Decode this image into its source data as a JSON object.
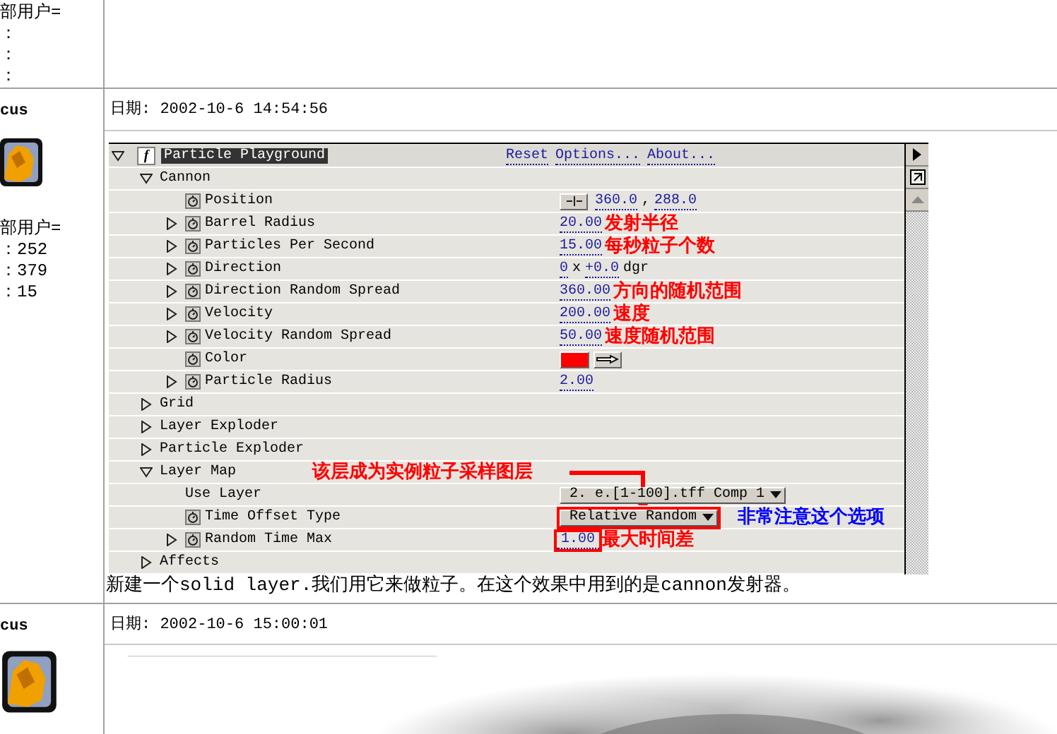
{
  "top_user": {
    "group": "部用户=",
    "stats": [
      "：",
      "：",
      "："
    ]
  },
  "posts": [
    {
      "user": {
        "name": "cus",
        "group": "部用户=",
        "stats": [
          "：252",
          "：379",
          "：15"
        ]
      },
      "date": "日期: 2002-10-6 14:54:56",
      "effect": {
        "title": "Particle Playground",
        "expanded": true,
        "switch": {
          "glyph": "f",
          "on": true
        },
        "links": [
          "Reset",
          "Options...",
          "About..."
        ],
        "properties": [
          {
            "label": "Cannon",
            "expanded": true,
            "stopwatch": false,
            "children": [
              {
                "label": "Position",
                "stopwatch": true,
                "kind": "point",
                "values": [
                  "360.0",
                  "288.0"
                ],
                "separator": ","
              },
              {
                "label": "Barrel Radius",
                "expanded": false,
                "stopwatch": true,
                "kind": "number",
                "value": "20.00",
                "note": {
                  "text": "发射半径",
                  "color": "#ff0000"
                }
              },
              {
                "label": "Particles Per Second",
                "expanded": false,
                "stopwatch": true,
                "kind": "number",
                "value": "15.00",
                "note": {
                  "text": "每秒粒子个数",
                  "color": "#ff0000"
                }
              },
              {
                "label": "Direction",
                "expanded": false,
                "stopwatch": true,
                "kind": "angle",
                "values": [
                  "0",
                  "+0.0"
                ],
                "separator": "x",
                "unit": "dgr"
              },
              {
                "label": "Direction Random Spread",
                "expanded": false,
                "stopwatch": true,
                "kind": "number",
                "value": "360.00",
                "note": {
                  "text": "方向的随机范围",
                  "color": "#ff0000"
                }
              },
              {
                "label": "Velocity",
                "expanded": false,
                "stopwatch": true,
                "kind": "number",
                "value": "200.00",
                "note": {
                  "text": "速度",
                  "color": "#ff0000"
                }
              },
              {
                "label": "Velocity Random Spread",
                "expanded": false,
                "stopwatch": true,
                "kind": "number",
                "value": "50.00",
                "note": {
                  "text": "速度随机范围",
                  "color": "#ff0000"
                }
              },
              {
                "label": "Color",
                "stopwatch": true,
                "kind": "color",
                "color": "#ff0000"
              },
              {
                "label": "Particle Radius",
                "expanded": false,
                "stopwatch": true,
                "kind": "number",
                "value": "2.00"
              }
            ]
          },
          {
            "label": "Grid",
            "expanded": false,
            "stopwatch": false
          },
          {
            "label": "Layer Exploder",
            "expanded": false,
            "stopwatch": false
          },
          {
            "label": "Particle Exploder",
            "expanded": false,
            "stopwatch": false
          },
          {
            "label": "Layer Map",
            "expanded": true,
            "stopwatch": false,
            "callout": "该层成为实例粒子采样图层",
            "children": [
              {
                "label": "Use Layer",
                "stopwatch": false,
                "kind": "dropdown",
                "value": "2. e.[1-100].tff Comp 1",
                "boxed": false
              },
              {
                "label": "Time Offset Type",
                "stopwatch": true,
                "kind": "dropdown",
                "value": "Relative Random",
                "boxed": true,
                "note": {
                  "text": "非常注意这个选项",
                  "color": "#0000ff"
                }
              },
              {
                "label": "Random Time Max",
                "expanded": false,
                "stopwatch": true,
                "kind": "number",
                "value": "1.00",
                "boxed": true,
                "note": {
                  "text": "最大时间差",
                  "color": "#ff0000"
                }
              }
            ]
          },
          {
            "label": "Affects",
            "expanded": false,
            "stopwatch": false
          }
        ]
      },
      "caption": "新建一个solid layer.我们用它来做粒子。在这个效果中用到的是cannon发射器。"
    },
    {
      "user": {
        "name": "cus"
      },
      "date": "日期: 2002-10-6 15:00:01"
    }
  ]
}
